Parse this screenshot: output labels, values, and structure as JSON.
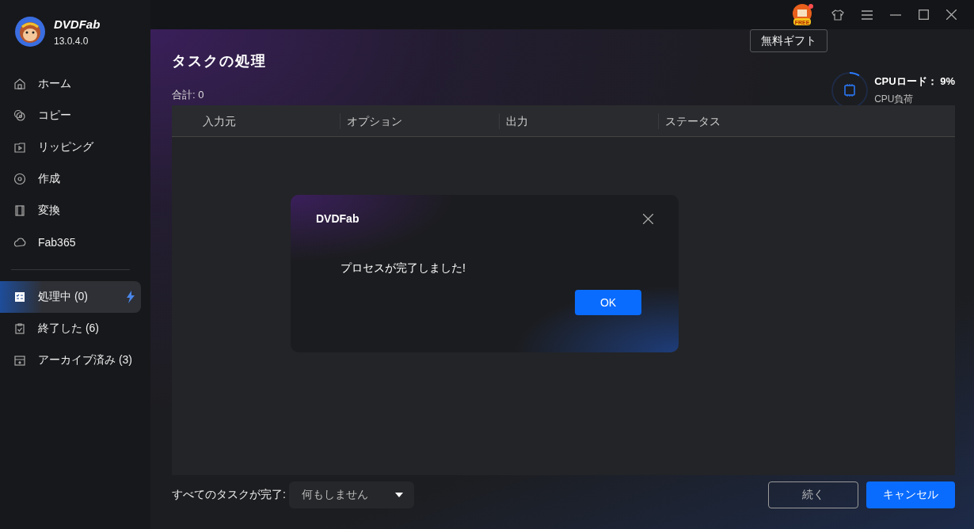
{
  "app": {
    "name": "DVDFab",
    "version": "13.0.4.0"
  },
  "sidebar": {
    "nav_items": [
      {
        "label": "ホーム",
        "selected": false
      },
      {
        "label": "コピー",
        "selected": false
      },
      {
        "label": "リッピング",
        "selected": false
      },
      {
        "label": "作成",
        "selected": false
      },
      {
        "label": "変換",
        "selected": false
      },
      {
        "label": "Fab365",
        "selected": false
      }
    ],
    "task_items": [
      {
        "label": "処理中 (0)",
        "selected": true,
        "boost": true
      },
      {
        "label": "終了した (6)",
        "selected": false,
        "boost": false
      },
      {
        "label": "アーカイブ済み (3)",
        "selected": false,
        "boost": false
      }
    ]
  },
  "title_bar": {
    "gift_badge": "FREE",
    "gift_tooltip": "無料ギフト"
  },
  "page": {
    "title": "タスクの処理",
    "total": "合計: 0",
    "cpu": {
      "label": "CPUロード：",
      "value": "9%",
      "sub": "CPU負荷",
      "level": 0.09
    },
    "table": {
      "columns": [
        "入力元",
        "オプション",
        "出力",
        "ステータス"
      ]
    },
    "footer": {
      "label": "すべてのタスクが完了:",
      "select_value": "何もしません",
      "buttons": [
        {
          "label": "続く",
          "kind": "outline"
        },
        {
          "label": "キャンセル",
          "kind": "primary"
        }
      ]
    }
  },
  "dialog": {
    "title": "DVDFab",
    "message": "プロセスが完了しました!",
    "button": "OK"
  }
}
